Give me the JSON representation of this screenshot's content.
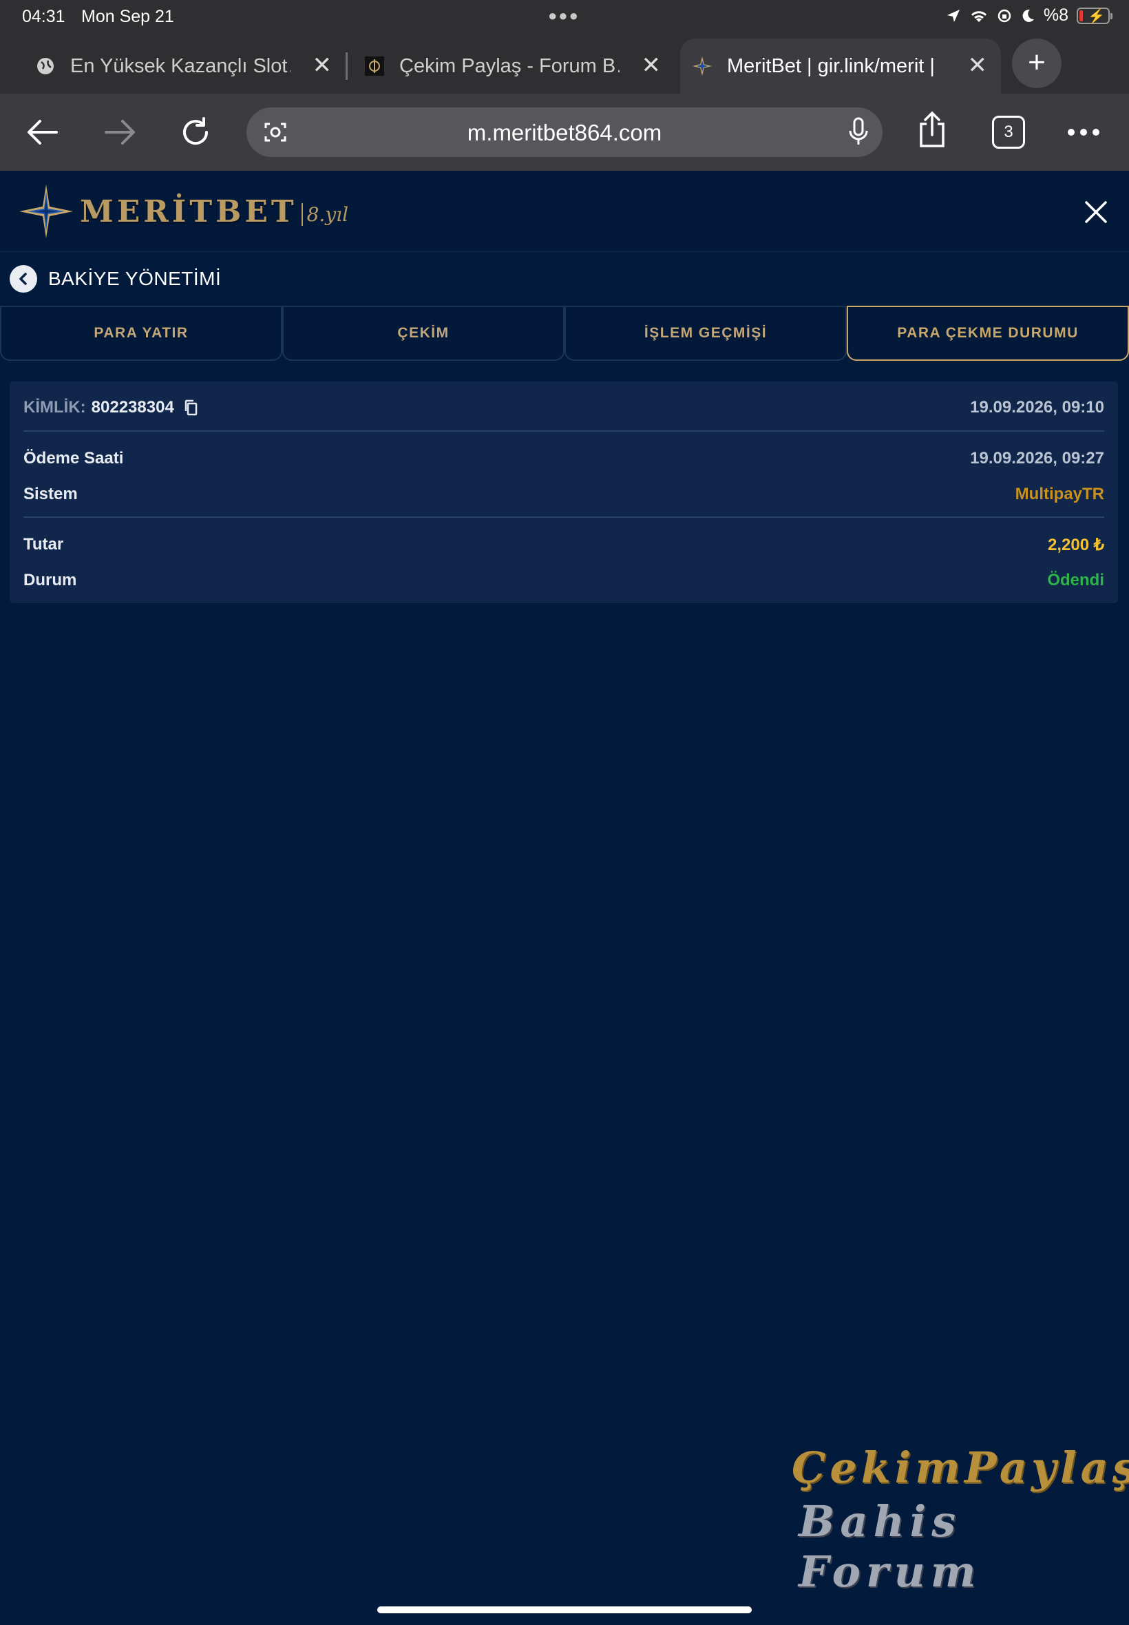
{
  "status_bar": {
    "time": "04:31",
    "date": "Mon Sep 21",
    "battery_text": "%8",
    "battery_level_percent": 8
  },
  "browser_tabs": [
    {
      "title": "En Yüksek Kazançlı Slot…",
      "icon": "globe-icon"
    },
    {
      "title": "Çekim Paylaş - Forum B…",
      "icon": "forum-favicon"
    },
    {
      "title": "MeritBet | gir.link/merit |",
      "icon": "meritbet-favicon",
      "active": true
    }
  ],
  "toolbar": {
    "url": "m.meritbet864.com",
    "tab_count": "3"
  },
  "site": {
    "logo_word": "MERİTBET",
    "logo_year": "8.yıl",
    "brand_gold": "#c9a96b"
  },
  "page": {
    "title": "BAKİYE YÖNETİMİ",
    "tabs": [
      "PARA YATIR",
      "ÇEKİM",
      "İŞLEM GEÇMİŞİ",
      "PARA ÇEKME DURUMU"
    ],
    "active_tab": 3
  },
  "record": {
    "id_label": "KİMLİK:",
    "id_value": "802238304",
    "created": "19.09.2026, 09:10",
    "payment_time_label": "Ödeme Saati",
    "payment_time": "19.09.2026, 09:27",
    "system_label": "Sistem",
    "system": "MultipayTR",
    "amount_label": "Tutar",
    "amount": "2,200 ₺",
    "status_label": "Durum",
    "status": "Ödendi",
    "colors": {
      "system": "#c8901e",
      "amount": "#f2c230",
      "status": "#2fb34a"
    }
  },
  "watermark": {
    "line1": "ÇekimPaylaş",
    "line2": "Bahis Forum"
  }
}
